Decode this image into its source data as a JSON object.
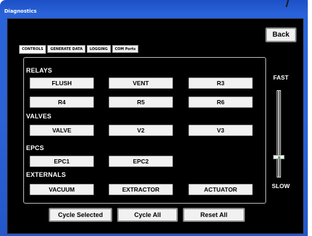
{
  "window": {
    "title": "Diagnostics"
  },
  "header": {
    "back_label": "Back"
  },
  "tabs": [
    {
      "label": "CONTROLS",
      "active": true
    },
    {
      "label": "GENERATE DATA",
      "active": false
    },
    {
      "label": "LOGGING",
      "active": false
    },
    {
      "label": "COM Ports",
      "active": false
    }
  ],
  "sections": {
    "relays": {
      "label": "RELAYS",
      "buttons": [
        "FLUSH",
        "VENT",
        "R3",
        "R4",
        "R5",
        "R6"
      ]
    },
    "valves": {
      "label": "VALVES",
      "buttons": [
        "VALVE",
        "V2",
        "V3"
      ]
    },
    "epcs": {
      "label": "EPCS",
      "buttons": [
        "EPC1",
        "EPC2"
      ]
    },
    "externals": {
      "label": "EXTERNALS",
      "buttons": [
        "VACUUM",
        "EXTRACTOR",
        "ACTUATOR"
      ]
    }
  },
  "speed": {
    "fast_label": "FAST",
    "slow_label": "SLOW",
    "value_fraction": 0.22
  },
  "footer": {
    "cycle_selected": "Cycle Selected",
    "cycle_all": "Cycle All",
    "reset_all": "Reset All"
  },
  "colors": {
    "frame": "#2b62d6",
    "screen": "#000000",
    "button": "#f1f1f1"
  },
  "icons": {
    "slider_thumb": "slider-thumb-icon"
  }
}
